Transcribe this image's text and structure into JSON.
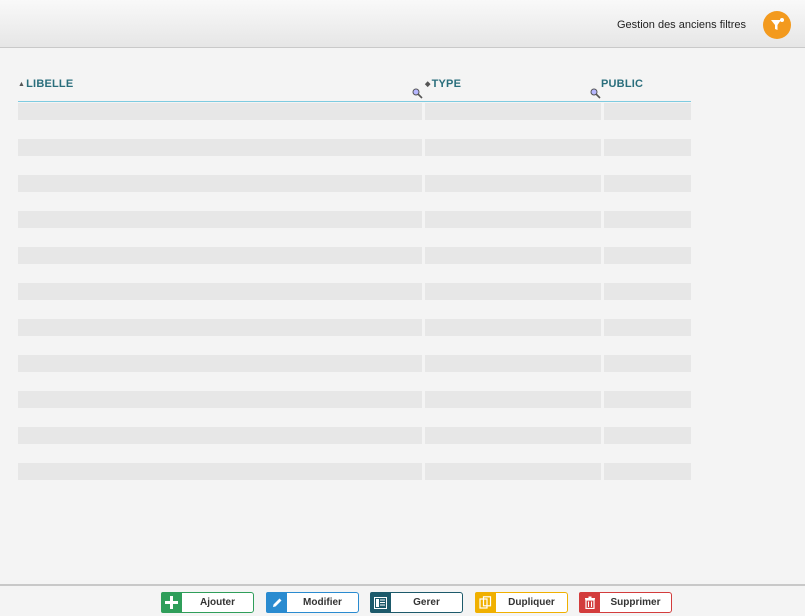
{
  "header": {
    "title": "Gestion des anciens filtres",
    "icon": "filter-icon",
    "accent_color": "#f39a1e"
  },
  "table": {
    "columns": [
      {
        "label": "LIBELLE",
        "sort": "ascending"
      },
      {
        "label": "TYPE",
        "sort": "none"
      },
      {
        "label": "PUBLIC",
        "sort": "none"
      }
    ],
    "empty_row_count": 11
  },
  "toolbar": {
    "buttons": [
      {
        "label": "Ajouter",
        "icon": "plus-icon",
        "color": "#2f9e5a"
      },
      {
        "label": "Modifier",
        "icon": "pencil-icon",
        "color": "#2a8bd0"
      },
      {
        "label": "Gerer",
        "icon": "list-icon",
        "color": "#1d5a6b"
      },
      {
        "label": "Dupliquer",
        "icon": "copy-icon",
        "color": "#f0b000"
      },
      {
        "label": "Supprimer",
        "icon": "trash-icon",
        "color": "#d33c3c"
      }
    ]
  }
}
